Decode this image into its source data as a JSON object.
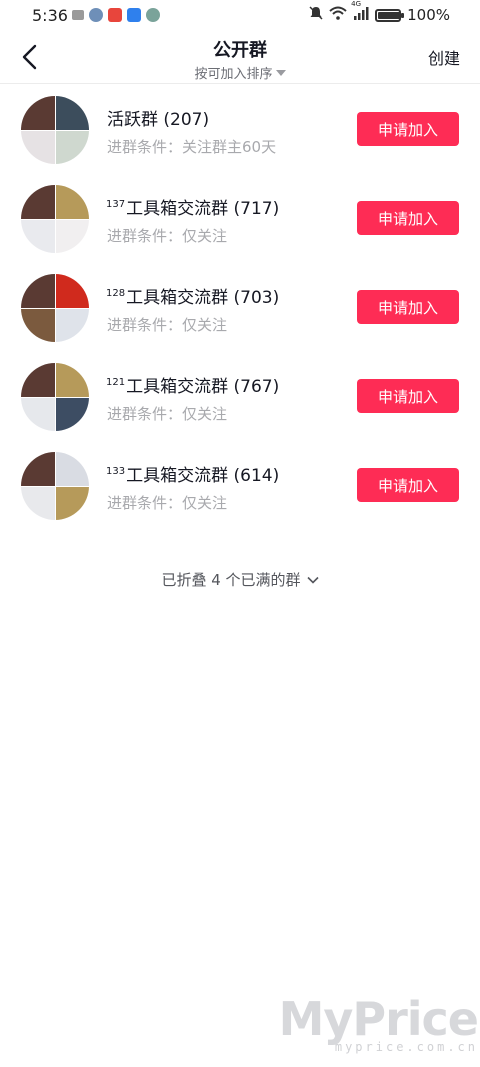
{
  "status_bar": {
    "time": "5:36",
    "battery_text": "100%",
    "battery_level": 1.0,
    "network": "4G"
  },
  "nav": {
    "title": "公开群",
    "sort_label": "按可加入排序",
    "create_label": "创建"
  },
  "groups": [
    {
      "prefix": "",
      "name": "活跃群 (207)",
      "condition": "进群条件：关注群主60天",
      "join_label": "申请加入",
      "avatar_colors": [
        "#5a3a33",
        "#3c4d5c",
        "#e6e2e4",
        "#cfd8cf"
      ]
    },
    {
      "prefix": "137",
      "name": "工具箱交流群 (717)",
      "condition": "进群条件：仅关注",
      "join_label": "申请加入",
      "avatar_colors": [
        "#5a3a33",
        "#b69a5a",
        "#e9eaee",
        "#f1eff0"
      ]
    },
    {
      "prefix": "128",
      "name": "工具箱交流群 (703)",
      "condition": "进群条件：仅关注",
      "join_label": "申请加入",
      "avatar_colors": [
        "#5a3a33",
        "#d02a1d",
        "#7b5a3e",
        "#dfe3ea"
      ]
    },
    {
      "prefix": "121",
      "name": "工具箱交流群 (767)",
      "condition": "进群条件：仅关注",
      "join_label": "申请加入",
      "avatar_colors": [
        "#5a3a33",
        "#b69a5a",
        "#e6e8ec",
        "#3d4d63"
      ]
    },
    {
      "prefix": "133",
      "name": "工具箱交流群 (614)",
      "condition": "进群条件：仅关注",
      "join_label": "申请加入",
      "avatar_colors": [
        "#5a3a33",
        "#d9dce3",
        "#e8e9ec",
        "#b69a5a"
      ]
    }
  ],
  "collapse_text": "已折叠 4 个已满的群",
  "watermark": {
    "brand": "MyPrice",
    "url": "myprice.com.cn"
  },
  "colors": {
    "accent": "#fe2c55",
    "text_primary": "#161823",
    "text_secondary": "#a8a9ad"
  }
}
